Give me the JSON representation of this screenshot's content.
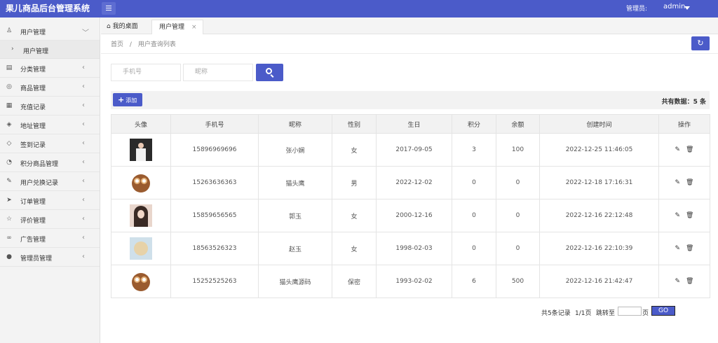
{
  "app_title": "果儿商品后台管理系统",
  "header": {
    "admin_label": "管理员:",
    "admin_name": "admin"
  },
  "sidebar": {
    "items": [
      {
        "label": "用户管理",
        "icon": "user-icon",
        "glyph": "♙"
      },
      {
        "label": "分类管理",
        "icon": "category-icon",
        "glyph": "▤"
      },
      {
        "label": "商品管理",
        "icon": "goods-icon",
        "glyph": "◎"
      },
      {
        "label": "充值记录",
        "icon": "calendar-icon",
        "glyph": "▦"
      },
      {
        "label": "地址管理",
        "icon": "layers-icon",
        "glyph": "◈"
      },
      {
        "label": "签到记录",
        "icon": "shield-icon",
        "glyph": "◇"
      },
      {
        "label": "积分商品管理",
        "icon": "dashboard-icon",
        "glyph": "◔"
      },
      {
        "label": "用户兑换记录",
        "icon": "edit-icon",
        "glyph": "✎"
      },
      {
        "label": "订单管理",
        "icon": "send-icon",
        "glyph": "➤"
      },
      {
        "label": "评价管理",
        "icon": "star-icon",
        "glyph": "☆"
      },
      {
        "label": "广告管理",
        "icon": "glasses-icon",
        "glyph": "∞"
      },
      {
        "label": "管理员管理",
        "icon": "admin-user-icon",
        "glyph": "●"
      }
    ],
    "sub_item": "用户管理"
  },
  "tabs": {
    "home": "我的桌面",
    "active": "用户管理",
    "close": "×"
  },
  "breadcrumb": {
    "home": "首页",
    "sep": "/",
    "current": "用户查询列表"
  },
  "search": {
    "phone_placeholder": "手机号",
    "nickname_placeholder": "昵称"
  },
  "toolbar": {
    "add_label": "添加",
    "total_label": "共有数据：",
    "total_count": "5",
    "total_unit": "条"
  },
  "table": {
    "headers": [
      "头像",
      "手机号",
      "昵称",
      "性别",
      "生日",
      "积分",
      "余额",
      "创建时间",
      "操作"
    ],
    "rows": [
      {
        "avatar": "dark",
        "phone": "15896969696",
        "nickname": "张小娴",
        "gender": "女",
        "birthday": "2017-09-05",
        "points": "3",
        "balance": "100",
        "created": "2022-12-25 11:46:05"
      },
      {
        "avatar": "owl",
        "phone": "15263636363",
        "nickname": "猫头鹰",
        "gender": "男",
        "birthday": "2022-12-02",
        "points": "0",
        "balance": "0",
        "created": "2022-12-18 17:16:31"
      },
      {
        "avatar": "girl",
        "phone": "15859656565",
        "nickname": "郭玉",
        "gender": "女",
        "birthday": "2000-12-16",
        "points": "0",
        "balance": "0",
        "created": "2022-12-16 22:12:48"
      },
      {
        "avatar": "dog",
        "phone": "18563526323",
        "nickname": "赵玉",
        "gender": "女",
        "birthday": "1998-02-03",
        "points": "0",
        "balance": "0",
        "created": "2022-12-16 22:10:39"
      },
      {
        "avatar": "owl",
        "phone": "15252525263",
        "nickname": "猫头鹰源码",
        "gender": "保密",
        "birthday": "1993-02-02",
        "points": "6",
        "balance": "500",
        "created": "2022-12-16 21:42:47"
      }
    ]
  },
  "pager": {
    "records": "共5条记录",
    "pages": "1/1页",
    "jump_label": "跳转至",
    "page_unit": "页",
    "go": "GO"
  },
  "colors": {
    "primary": "#4b5bc9",
    "sidebar_bg": "#f3f3f3"
  }
}
